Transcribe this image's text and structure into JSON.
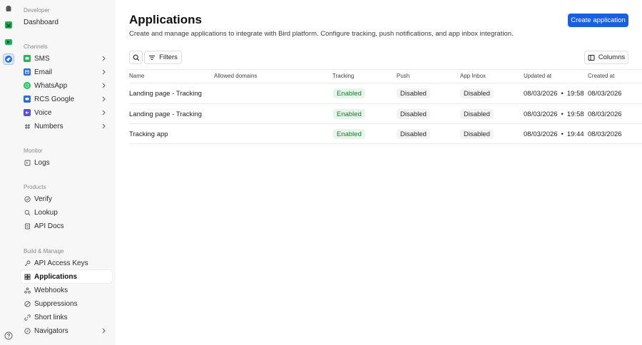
{
  "colors": {
    "accent": "#1a5fe0",
    "enabled_bg": "#e6f6ea",
    "enabled_text": "#1c7a34",
    "sms": "#1fb85a",
    "email": "#2a6be0",
    "whatsapp": "#22c35e",
    "rcs": "#2a6be0",
    "voice": "#5b4de0"
  },
  "rail": {
    "items": [
      "home-icon",
      "channel-icon",
      "video-icon",
      "bird-app-icon"
    ],
    "help_icon": "help-icon"
  },
  "sidebar": {
    "developer_label": "Developer",
    "dashboard": "Dashboard",
    "channels_label": "Channels",
    "channels": [
      {
        "label": "SMS",
        "icon": "sms-icon"
      },
      {
        "label": "Email",
        "icon": "email-icon"
      },
      {
        "label": "WhatsApp",
        "icon": "whatsapp-icon"
      },
      {
        "label": "RCS Google",
        "icon": "rcs-icon"
      },
      {
        "label": "Voice",
        "icon": "voice-icon"
      },
      {
        "label": "Numbers",
        "icon": "hash-icon"
      }
    ],
    "monitor_label": "Monitor",
    "logs": "Logs",
    "products_label": "Products",
    "products": [
      {
        "label": "Verify",
        "icon": "check-circle-icon"
      },
      {
        "label": "Lookup",
        "icon": "search-icon"
      },
      {
        "label": "API Docs",
        "icon": "doc-icon"
      }
    ],
    "build_label": "Build & Manage",
    "build": [
      {
        "label": "API Access Keys",
        "icon": "key-icon"
      },
      {
        "label": "Applications",
        "icon": "grid-icon"
      },
      {
        "label": "Webhooks",
        "icon": "webhook-icon"
      },
      {
        "label": "Suppressions",
        "icon": "block-icon"
      },
      {
        "label": "Short links",
        "icon": "link-icon"
      },
      {
        "label": "Navigators",
        "icon": "compass-icon"
      }
    ]
  },
  "main": {
    "title": "Applications",
    "subtitle": "Create and manage applications to integrate with Bird platform. Configure tracking, push notifications, and app inbox integration.",
    "create_button": "Create application",
    "filters_button": "Filters",
    "columns_button": "Columns"
  },
  "table": {
    "headers": [
      "Name",
      "Allowed domains",
      "Tracking",
      "Push",
      "App Inbox",
      "Updated at",
      "Created at"
    ],
    "rows": [
      {
        "name": "Landing page - Tracking",
        "domains": "",
        "tracking": "Enabled",
        "push": "Disabled",
        "inbox": "Disabled",
        "updated_date": "08/03/2026",
        "updated_sep": "•",
        "updated_time": "19:58",
        "created": "08/03/2026"
      },
      {
        "name": "Landing page - Tracking",
        "domains": "",
        "tracking": "Enabled",
        "push": "Disabled",
        "inbox": "Disabled",
        "updated_date": "08/03/2026",
        "updated_sep": "•",
        "updated_time": "19:58",
        "created": "08/03/2026"
      },
      {
        "name": "Tracking app",
        "domains": "",
        "tracking": "Enabled",
        "push": "Disabled",
        "inbox": "Disabled",
        "updated_date": "08/03/2026",
        "updated_sep": "•",
        "updated_time": "19:44",
        "created": "08/03/2026"
      }
    ]
  }
}
